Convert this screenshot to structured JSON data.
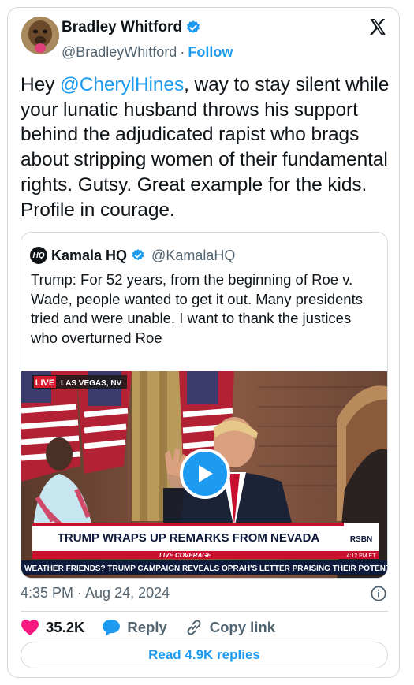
{
  "author": {
    "name": "Bradley Whitford",
    "handle": "@BradleyWhitford",
    "separator": "·",
    "follow_label": "Follow",
    "verified_color": "#1d9bf0"
  },
  "tweet": {
    "text_before": "Hey ",
    "mention": "@CherylHines",
    "text_after": ", way to stay silent while your lunatic husband throws his support behind the adjudicated rapist who brags about stripping women of their fundamental rights. Gutsy. Great example for the kids. Profile in courage."
  },
  "quote": {
    "logo_text": "HQ",
    "name": "Kamala HQ",
    "handle": "@KamalaHQ",
    "text": "Trump: For 52 years, from the beginning of Roe v. Wade, people wanted to get it out. Many presidents tried and were unable. I want to thank the justices who overturned Roe",
    "video": {
      "live_badge": "LIVE",
      "location": "LAS VEGAS, NV",
      "live_coverage": "LIVE COVERAGE",
      "headline": "TRUMP WRAPS UP REMARKS FROM NEVADA",
      "network": "RSBN",
      "time": "4:12 PM ET",
      "ticker": "WEATHER FRIENDS? TRUMP CAMPAIGN REVEALS OPRAH'S LETTER PRAISING THEIR POTENTIAL AS"
    }
  },
  "meta": {
    "timestamp": "4:35 PM · Aug 24, 2024"
  },
  "actions": {
    "likes": "35.2K",
    "reply_label": "Reply",
    "copy_label": "Copy link",
    "read_replies": "Read 4.9K replies"
  },
  "colors": {
    "accent": "#1d9bf0",
    "heart": "#f91880",
    "muted": "#536471",
    "border": "#cfd9de"
  }
}
